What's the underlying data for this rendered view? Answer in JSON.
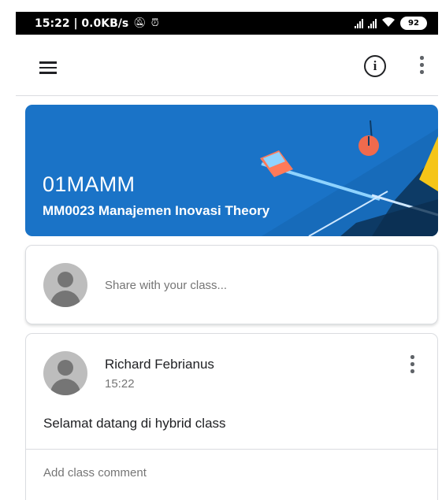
{
  "status_bar": {
    "time_speed": "15:22 | 0.0KB/s",
    "mute_icon": "bell-off-icon",
    "alarm_icon": "alarm-clock-icon",
    "battery": "92"
  },
  "app_bar": {
    "menu_icon": "hamburger-menu-icon",
    "info_icon": "info-circle-icon",
    "more_icon": "more-vertical-icon",
    "info_glyph": "i"
  },
  "banner": {
    "class_name": "01MAMM",
    "class_subtitle": "MM0023  Manajemen Inovasi Theory",
    "color": "#1a73c7"
  },
  "share": {
    "placeholder": "Share with your class..."
  },
  "post": {
    "author": "Richard Febrianus",
    "time": "15:22",
    "text": "Selamat datang di hybrid class",
    "comment_placeholder": "Add class comment"
  }
}
